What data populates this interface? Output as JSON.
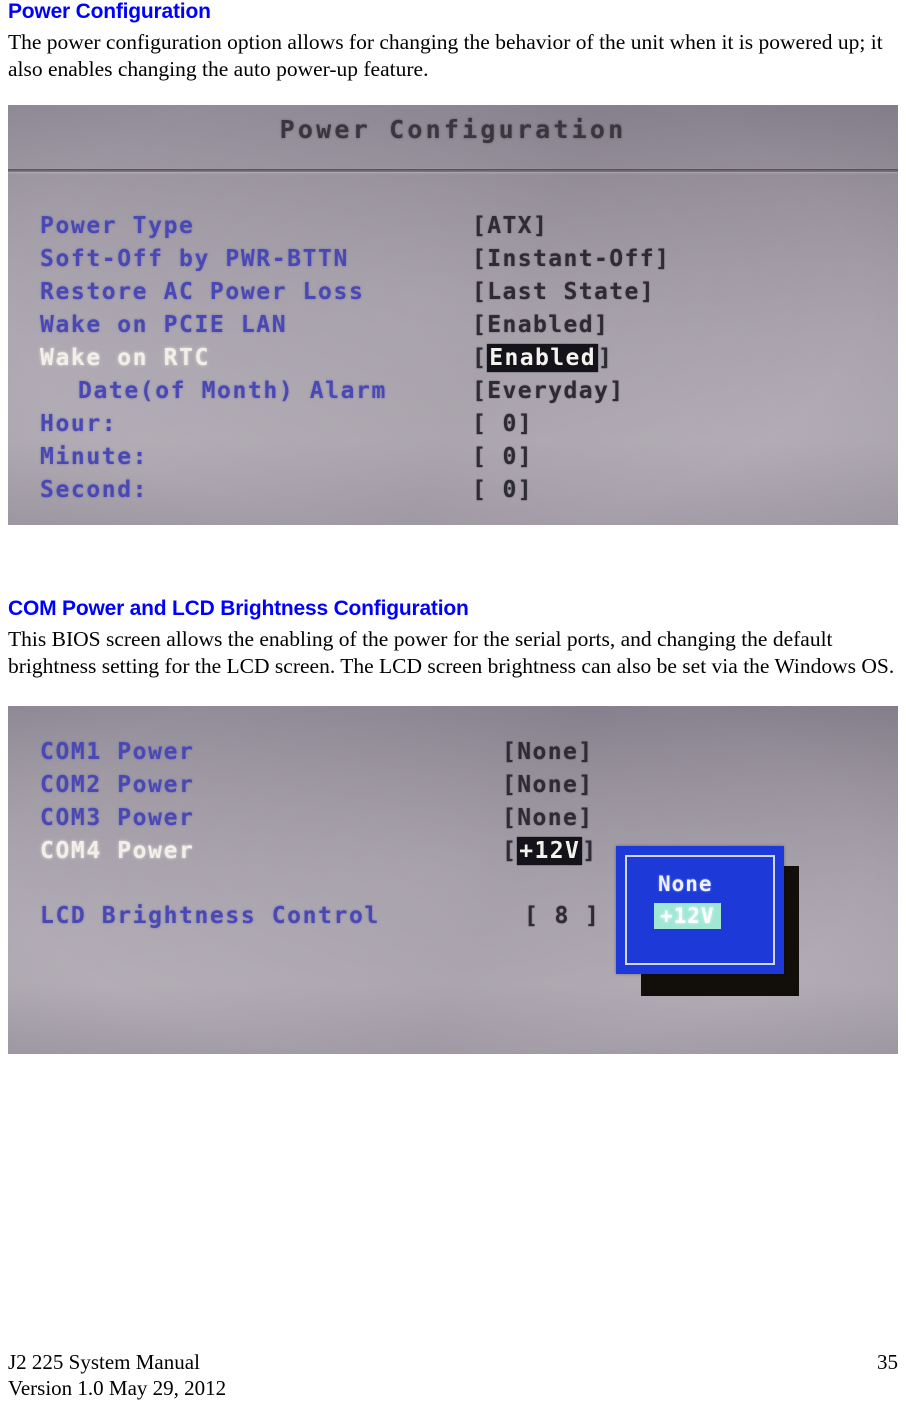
{
  "document": {
    "sections": [
      {
        "heading": "Power Configuration",
        "body": "The power configuration option allows for changing the behavior of the unit when it is powered up; it also enables changing the auto power-up feature."
      },
      {
        "heading": "COM Power and LCD Brightness Configuration",
        "body": "This BIOS screen allows the enabling of the power for the serial ports, and changing the default brightness setting for the LCD screen. The LCD screen brightness can also be set via the Windows OS."
      }
    ]
  },
  "bios_power": {
    "title": "Power Configuration",
    "rows": [
      {
        "label": "Power Type",
        "value": "[ATX]",
        "indent": false,
        "selected": false,
        "highlight": false
      },
      {
        "label": "Soft-Off by PWR-BTTN",
        "value": "[Instant-Off]",
        "indent": false,
        "selected": false,
        "highlight": false
      },
      {
        "label": "Restore AC Power Loss",
        "value": "[Last State]",
        "indent": false,
        "selected": false,
        "highlight": false
      },
      {
        "label": "Wake on PCIE LAN",
        "value": "[Enabled]",
        "indent": false,
        "selected": false,
        "highlight": false
      },
      {
        "label": "Wake on RTC",
        "value": "[Enabled]",
        "indent": false,
        "selected": true,
        "highlight": true
      },
      {
        "label": "Date(of Month) Alarm",
        "value": "[Everyday]",
        "indent": true,
        "selected": false,
        "highlight": false
      },
      {
        "label": "Hour:",
        "value": "[ 0]",
        "indent": false,
        "selected": false,
        "highlight": false
      },
      {
        "label": "Minute:",
        "value": "[ 0]",
        "indent": false,
        "selected": false,
        "highlight": false
      },
      {
        "label": "Second:",
        "value": "[ 0]",
        "indent": false,
        "selected": false,
        "highlight": false
      }
    ]
  },
  "bios_com": {
    "rows": [
      {
        "label": "COM1 Power",
        "value": "[None]",
        "selected": false,
        "highlight": false
      },
      {
        "label": "COM2 Power",
        "value": "[None]",
        "selected": false,
        "highlight": false
      },
      {
        "label": "COM3 Power",
        "value": "[None]",
        "selected": false,
        "highlight": false
      },
      {
        "label": "COM4 Power",
        "value": "[+12V]",
        "selected": true,
        "highlight": true
      }
    ],
    "lcd_row": {
      "label": "LCD Brightness Control",
      "value": "[ 8 ]"
    },
    "popup": {
      "options": [
        "None",
        "+12V"
      ],
      "selected": "+12V"
    }
  },
  "footer": {
    "manual_title": "J2 225 System Manual",
    "version_line": "Version 1.0 May 29, 2012",
    "page_number": "35"
  },
  "colors": {
    "heading_blue": "#0000ff",
    "bios_label_blue": "#4a49b4",
    "bios_selected_label": "#f2efe6",
    "bios_value_dark": "#2e2b34",
    "bios_highlight_bg": "#15131a",
    "popup_blue": "#1d3ad8",
    "popup_selected_bg": "#9fe8d6"
  }
}
